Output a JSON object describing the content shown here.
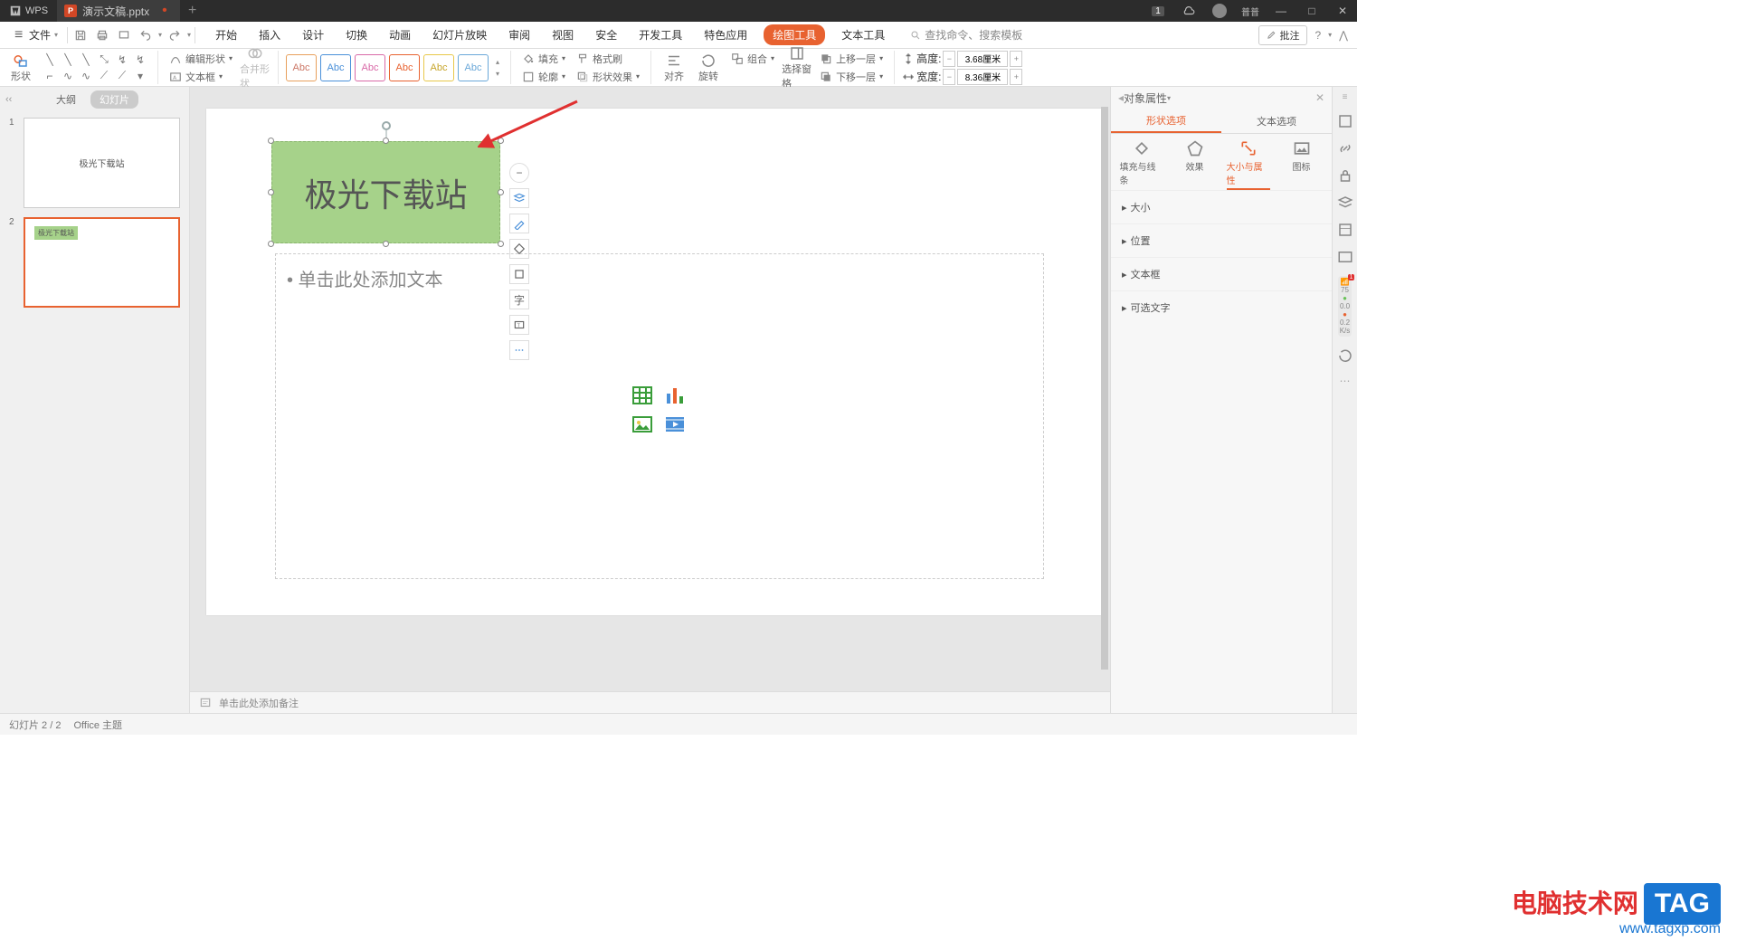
{
  "titlebar": {
    "app": "WPS",
    "filename": "演示文稿.pptx",
    "notif_count": "1",
    "username": "普普"
  },
  "menu": {
    "file": "文件",
    "tabs": [
      "开始",
      "插入",
      "设计",
      "切换",
      "动画",
      "幻灯片放映",
      "审阅",
      "视图",
      "安全",
      "开发工具",
      "特色应用",
      "绘图工具",
      "文本工具"
    ],
    "active_tab": "绘图工具",
    "search_placeholder": "查找命令、搜索模板",
    "annotate": "批注"
  },
  "ribbon": {
    "shape": "形状",
    "edit_shape": "编辑形状",
    "textbox": "文本框",
    "merge_shapes": "合并形状",
    "abc": "Abc",
    "fill": "填充",
    "outline": "轮廓",
    "format_painter": "格式刷",
    "shape_effects": "形状效果",
    "align": "对齐",
    "rotate": "旋转",
    "group": "组合",
    "selection_pane": "选择窗格",
    "bring_forward": "上移一层",
    "send_backward": "下移一层",
    "height_label": "高度:",
    "width_label": "宽度:",
    "height_value": "3.68厘米",
    "width_value": "8.36厘米"
  },
  "thumbs": {
    "outline": "大纲",
    "slides": "幻灯片",
    "slide1_text": "极光下载站",
    "slide2_text": "极光下载站"
  },
  "slide": {
    "title_text": "极光下载站",
    "body_placeholder": "• 单击此处添加文本"
  },
  "panel": {
    "title": "对象属性",
    "tab_shape": "形状选项",
    "tab_text": "文本选项",
    "sub_fill": "填充与线条",
    "sub_effect": "效果",
    "sub_size": "大小与属性",
    "sub_icon": "图标",
    "sec_size": "大小",
    "sec_pos": "位置",
    "sec_textbox": "文本框",
    "sec_alttext": "可选文字"
  },
  "speed": {
    "num": "75",
    "mid": "0.0",
    "low": "0.2",
    "unit": "K/s"
  },
  "notes": {
    "placeholder": "单击此处添加备注"
  },
  "status": {
    "slide_info": "幻灯片 2 / 2",
    "theme": "Office 主题"
  },
  "watermark": {
    "site": "电脑技术网",
    "tag": "TAG",
    "url": "www.tagxp.com"
  }
}
